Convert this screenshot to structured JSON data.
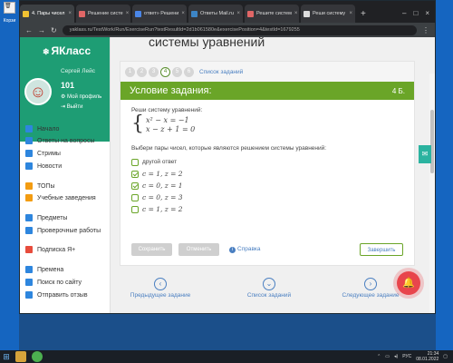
{
  "desktop": {
    "icon_label": "Корзи"
  },
  "browser": {
    "tabs": [
      {
        "label": "4. Пары чисел",
        "color": "#f1c232",
        "active": true
      },
      {
        "label": "Решение систе",
        "color": "#e06666",
        "active": false
      },
      {
        "label": "ответ» Решени",
        "color": "#4a86e8",
        "active": false
      },
      {
        "label": "Ответы Mail.ru",
        "color": "#3d85c6",
        "active": false
      },
      {
        "label": "Решите систем",
        "color": "#e06666",
        "active": false
      },
      {
        "label": "Реши систему",
        "color": "#dddddd",
        "active": false
      }
    ],
    "url": "yaklass.ru/TestWork/Run/ExerciseRun?testResultId=2d1b061580e&exercisePosition=4&testId=1679255"
  },
  "sidebar": {
    "logo": "ЯКласс",
    "user_name": "Сергей Лейс",
    "points": "101",
    "profile_link": "Мой профиль",
    "logout_link": "Выйти",
    "items": [
      {
        "label": "Начало",
        "color": "#2e86de"
      },
      {
        "label": "Ответы на вопросы",
        "color": "#2e86de"
      },
      {
        "label": "Стримы",
        "color": "#2e86de"
      },
      {
        "label": "Новости",
        "color": "#2e86de"
      },
      {
        "label": "ТОПы",
        "color": "#f39c12"
      },
      {
        "label": "Учебные заведения",
        "color": "#f39c12"
      },
      {
        "label": "Предметы",
        "color": "#2e86de"
      },
      {
        "label": "Проверочные работы",
        "color": "#2e86de"
      },
      {
        "label": "Подписка Я+",
        "color": "#e74c3c"
      },
      {
        "label": "Премена",
        "color": "#2e86de"
      },
      {
        "label": "Поиск по сайту",
        "color": "#2e86de"
      },
      {
        "label": "Отправить отзыв",
        "color": "#2e86de"
      }
    ]
  },
  "main": {
    "page_title": "системы уравнений",
    "steps": [
      "1",
      "2",
      "3",
      "4",
      "5",
      "6"
    ],
    "current_step": "4",
    "steps_link": "Список заданий",
    "condition_title": "Условие задания:",
    "points": "4 Б.",
    "prompt1": "Реши систему уравнений:",
    "equations": [
      "x² − x = −1",
      "x − z + 1 = 0"
    ],
    "prompt2": "Выбери пары чисел, которые являются решением системы уравнений:",
    "options": [
      {
        "label": "другой ответ",
        "math": false,
        "checked": false
      },
      {
        "label": "c = 1, z = 2",
        "math": true,
        "checked": true
      },
      {
        "label": "c = 0, z = 1",
        "math": true,
        "checked": true
      },
      {
        "label": "c = 0, z = 3",
        "math": true,
        "checked": false
      },
      {
        "label": "c = 1, z = 2",
        "math": true,
        "checked": false
      }
    ],
    "save_label": "Сохранить",
    "cancel_label": "Отменить",
    "help_label": "Справка",
    "finish_label": "Завершить",
    "prev_label": "Предыдущее задание",
    "list_label": "Список заданий",
    "next_label": "Следующее задание"
  },
  "taskbar": {
    "lang": "РУС",
    "time": "21:34",
    "date": "08.01.2022"
  }
}
